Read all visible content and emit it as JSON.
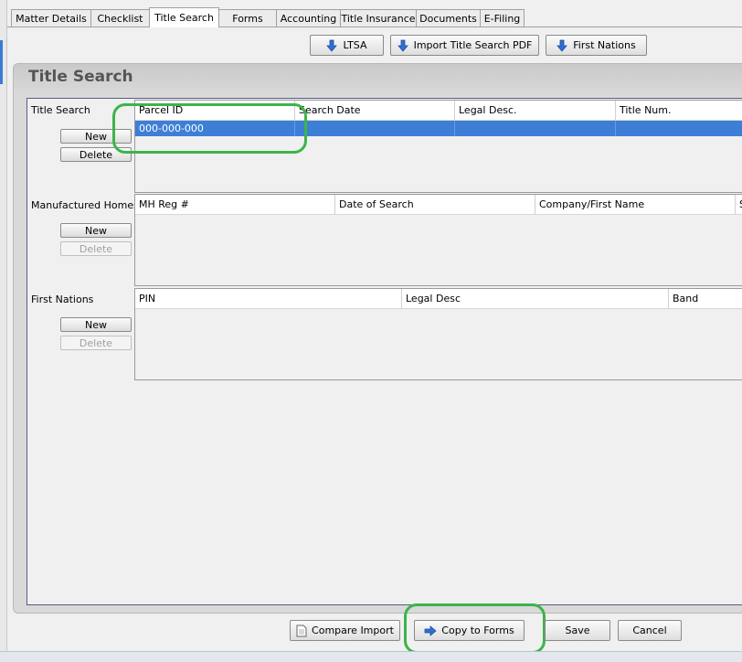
{
  "tabs": [
    {
      "label": "Matter Details",
      "active": false
    },
    {
      "label": "Checklist",
      "active": false
    },
    {
      "label": "Title Search",
      "active": true
    },
    {
      "label": "Forms",
      "active": false
    },
    {
      "label": "Accounting",
      "active": false
    },
    {
      "label": "Title Insurance",
      "active": false
    },
    {
      "label": "Documents",
      "active": false
    },
    {
      "label": "E-Filing",
      "active": false
    }
  ],
  "toolbar": {
    "ltsa_label": "LTSA",
    "import_label": "Import Title Search PDF",
    "first_nations_label": "First Nations",
    "icon": "arrow-down-icon"
  },
  "panel": {
    "title": "Title Search"
  },
  "sections": {
    "title_search": {
      "label": "Title Search",
      "new_label": "New",
      "delete_label": "Delete",
      "columns": [
        "Parcel ID",
        "Search Date",
        "Legal Desc.",
        "Title Num."
      ],
      "rows": [
        [
          "000-000-000",
          "",
          "",
          ""
        ]
      ]
    },
    "manufactured_homes": {
      "label": "Manufactured Homes",
      "new_label": "New",
      "delete_label": "Delete",
      "columns": [
        "MH Reg #",
        "Date of Search",
        "Company/First Name",
        "S"
      ]
    },
    "first_nations": {
      "label": "First Nations",
      "new_label": "New",
      "delete_label": "Delete",
      "columns": [
        "PIN",
        "Legal Desc",
        "Band"
      ]
    }
  },
  "footer": {
    "compare_label": "Compare Import",
    "copy_label": "Copy to Forms",
    "save_label": "Save",
    "cancel_label": "Cancel"
  },
  "colors": {
    "selection": "#3d7fd6",
    "highlight": "#3cb44b",
    "icon_blue": "#2f6fd0"
  }
}
